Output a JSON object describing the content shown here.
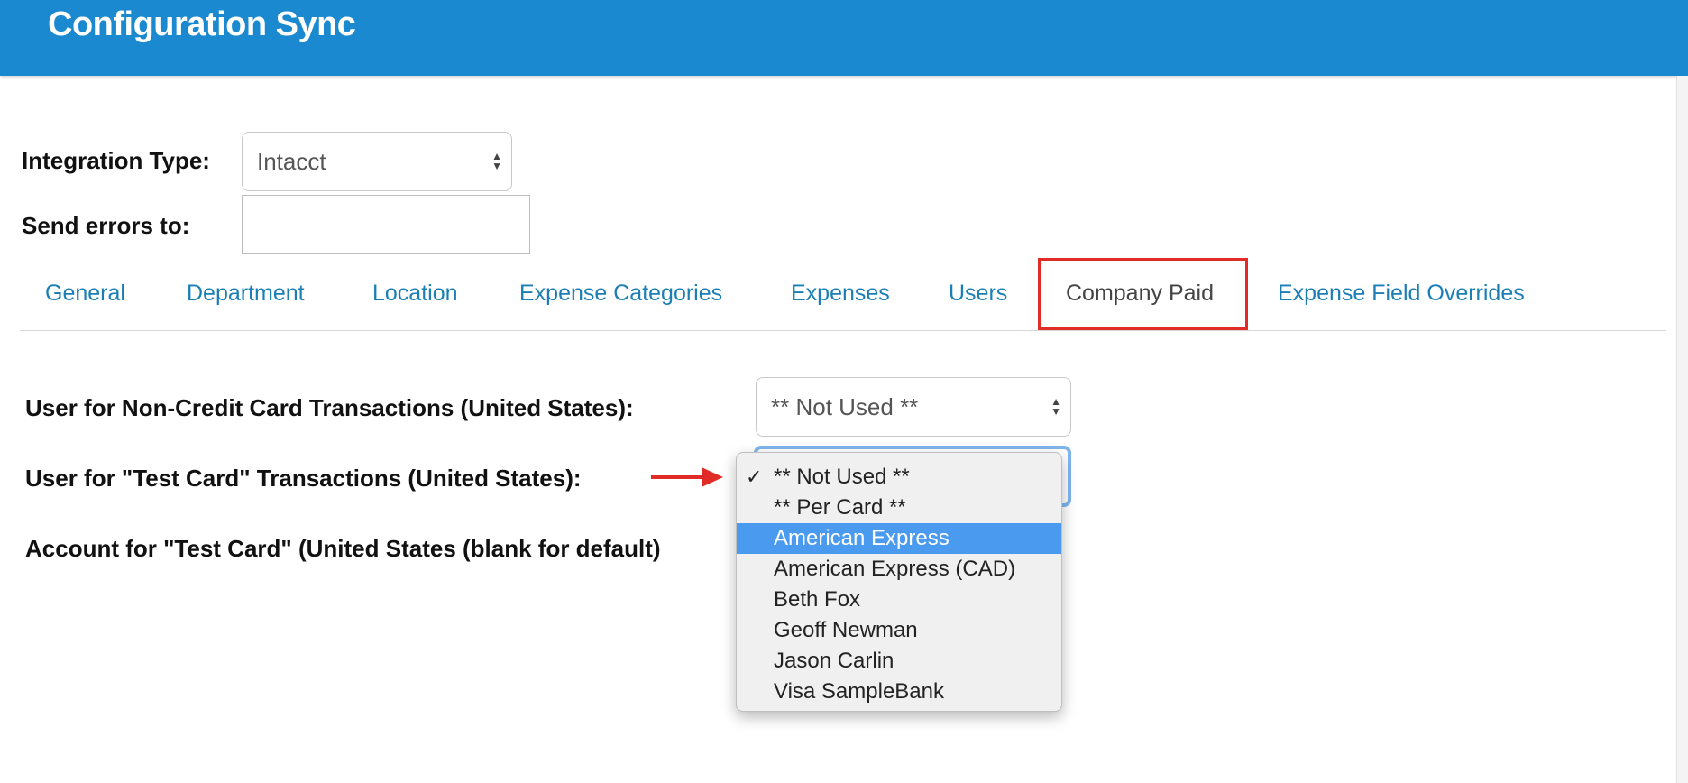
{
  "header": {
    "title": "Configuration Sync"
  },
  "form": {
    "integration_type_label": "Integration Type:",
    "integration_type_value": "Intacct",
    "send_errors_label": "Send errors to:",
    "send_errors_value": ""
  },
  "tabs": [
    {
      "label": "General",
      "active": false
    },
    {
      "label": "Department",
      "active": false
    },
    {
      "label": "Location",
      "active": false
    },
    {
      "label": "Expense Categories",
      "active": false
    },
    {
      "label": "Expenses",
      "active": false
    },
    {
      "label": "Users",
      "active": false
    },
    {
      "label": "Company Paid",
      "active": true
    },
    {
      "label": "Expense Field Overrides",
      "active": false
    }
  ],
  "company_paid": {
    "non_credit_label": "User for Non-Credit Card Transactions (United States):",
    "non_credit_value": "** Not Used **",
    "test_card_user_label": "User for \"Test Card\" Transactions (United States):",
    "test_card_account_label": "Account for \"Test Card\" (United States (blank for default)"
  },
  "dropdown": {
    "selected_index": 0,
    "highlighted_index": 2,
    "options": [
      "** Not Used **",
      "** Per Card **",
      "American Express",
      "American Express (CAD)",
      "Beth Fox",
      "Geoff Newman",
      "Jason Carlin",
      "Visa SampleBank"
    ]
  },
  "colors": {
    "header_bg": "#1a89cf",
    "tab_link": "#1b7fb6",
    "active_tab_outline": "#e02b27",
    "highlight": "#4a9bf0",
    "annotation_arrow": "#e02b27"
  }
}
